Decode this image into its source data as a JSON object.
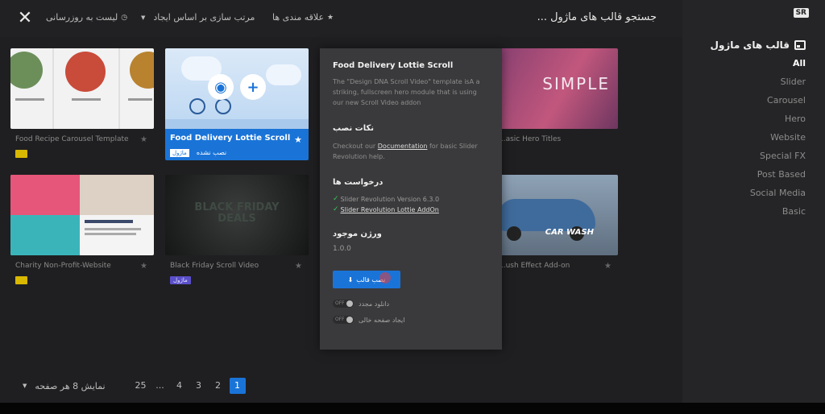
{
  "topbar": {
    "search_placeholder": "جستجو قالب های ماژول ...",
    "favorites": "علاقه مندی ها",
    "sort": "مرتب سازی بر اساس ایجاد",
    "update_list": "لیست به روزرسانی"
  },
  "sidebar": {
    "logo": "SR",
    "title": "قالب های ماژول",
    "items": [
      "All",
      "Slider",
      "Carousel",
      "Hero",
      "Website",
      "Special FX",
      "Post Based",
      "Social Media",
      "Basic"
    ]
  },
  "cards": {
    "food_recipe": {
      "title": "Food Recipe Carousel Template",
      "badge": ""
    },
    "featured": {
      "title": "Food Delivery Lottie Scroll",
      "badge": "ماژول",
      "status": "نصب نشده"
    },
    "simple_hero": {
      "title": "...asic Hero Titles",
      "thumb_text": "SIMPLE"
    },
    "charity": {
      "title": "Charity Non-Profit-Website",
      "badge": ""
    },
    "black_friday": {
      "title": "Black Friday Scroll Video",
      "badge": "ماژول",
      "thumb_text": "BLACK FRIDAY DEALS"
    },
    "car_wash": {
      "title": "...ush Effect Add-on",
      "thumb_text": "CAR WASH"
    }
  },
  "popup": {
    "title": "Food Delivery Lottie Scroll",
    "description": "The \"Design DNA Scroll Video\" template isA a striking, fullscreen hero module that is using our new Scroll Video addon",
    "install_notes_heading": "نکات نصب",
    "install_notes_prefix": "Checkout our ",
    "install_notes_link": "Documentation",
    "install_notes_suffix": " for basic Slider Revolution help.",
    "requirements_heading": "درخواست ها",
    "requirement_1": "Slider Revolution Version 6.3.0",
    "requirement_2": "Slider Revolution Lottie AddOn",
    "version_heading": "ورژن موجود",
    "version": "1.0.0",
    "install_button": "نصب قالب",
    "redownload_label": "دانلود مجدد",
    "blank_page_label": "ایجاد صفحه خالی",
    "toggle_off": "OFF"
  },
  "pagination": {
    "per_page": "نمایش 8 هر صفحه",
    "pages": [
      "25",
      "...",
      "4",
      "3",
      "2",
      "1"
    ],
    "active": "1"
  },
  "colors": {
    "accent": "#1a74d8",
    "background": "#1f1f21",
    "sidebar": "#252527",
    "popup": "#3a3a3c"
  }
}
